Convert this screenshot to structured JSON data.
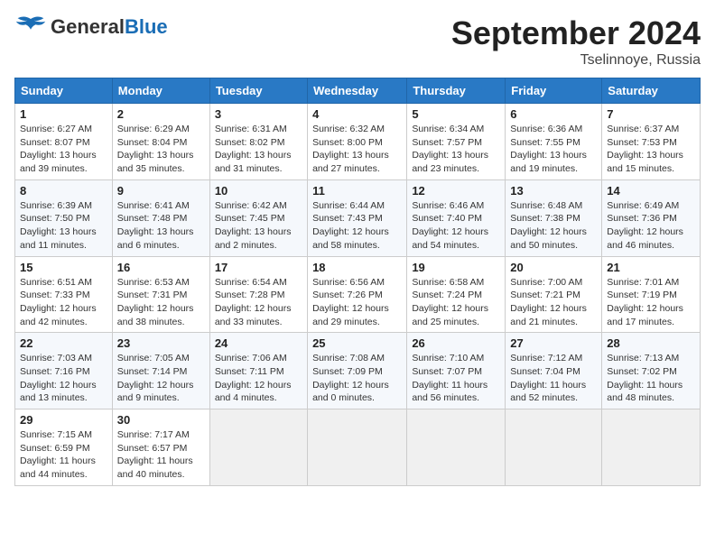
{
  "header": {
    "logo_general": "General",
    "logo_blue": "Blue",
    "month": "September 2024",
    "location": "Tselinnoye, Russia"
  },
  "columns": [
    "Sunday",
    "Monday",
    "Tuesday",
    "Wednesday",
    "Thursday",
    "Friday",
    "Saturday"
  ],
  "weeks": [
    [
      {
        "day": "1",
        "sunrise": "Sunrise: 6:27 AM",
        "sunset": "Sunset: 8:07 PM",
        "daylight": "Daylight: 13 hours and 39 minutes."
      },
      {
        "day": "2",
        "sunrise": "Sunrise: 6:29 AM",
        "sunset": "Sunset: 8:04 PM",
        "daylight": "Daylight: 13 hours and 35 minutes."
      },
      {
        "day": "3",
        "sunrise": "Sunrise: 6:31 AM",
        "sunset": "Sunset: 8:02 PM",
        "daylight": "Daylight: 13 hours and 31 minutes."
      },
      {
        "day": "4",
        "sunrise": "Sunrise: 6:32 AM",
        "sunset": "Sunset: 8:00 PM",
        "daylight": "Daylight: 13 hours and 27 minutes."
      },
      {
        "day": "5",
        "sunrise": "Sunrise: 6:34 AM",
        "sunset": "Sunset: 7:57 PM",
        "daylight": "Daylight: 13 hours and 23 minutes."
      },
      {
        "day": "6",
        "sunrise": "Sunrise: 6:36 AM",
        "sunset": "Sunset: 7:55 PM",
        "daylight": "Daylight: 13 hours and 19 minutes."
      },
      {
        "day": "7",
        "sunrise": "Sunrise: 6:37 AM",
        "sunset": "Sunset: 7:53 PM",
        "daylight": "Daylight: 13 hours and 15 minutes."
      }
    ],
    [
      {
        "day": "8",
        "sunrise": "Sunrise: 6:39 AM",
        "sunset": "Sunset: 7:50 PM",
        "daylight": "Daylight: 13 hours and 11 minutes."
      },
      {
        "day": "9",
        "sunrise": "Sunrise: 6:41 AM",
        "sunset": "Sunset: 7:48 PM",
        "daylight": "Daylight: 13 hours and 6 minutes."
      },
      {
        "day": "10",
        "sunrise": "Sunrise: 6:42 AM",
        "sunset": "Sunset: 7:45 PM",
        "daylight": "Daylight: 13 hours and 2 minutes."
      },
      {
        "day": "11",
        "sunrise": "Sunrise: 6:44 AM",
        "sunset": "Sunset: 7:43 PM",
        "daylight": "Daylight: 12 hours and 58 minutes."
      },
      {
        "day": "12",
        "sunrise": "Sunrise: 6:46 AM",
        "sunset": "Sunset: 7:40 PM",
        "daylight": "Daylight: 12 hours and 54 minutes."
      },
      {
        "day": "13",
        "sunrise": "Sunrise: 6:48 AM",
        "sunset": "Sunset: 7:38 PM",
        "daylight": "Daylight: 12 hours and 50 minutes."
      },
      {
        "day": "14",
        "sunrise": "Sunrise: 6:49 AM",
        "sunset": "Sunset: 7:36 PM",
        "daylight": "Daylight: 12 hours and 46 minutes."
      }
    ],
    [
      {
        "day": "15",
        "sunrise": "Sunrise: 6:51 AM",
        "sunset": "Sunset: 7:33 PM",
        "daylight": "Daylight: 12 hours and 42 minutes."
      },
      {
        "day": "16",
        "sunrise": "Sunrise: 6:53 AM",
        "sunset": "Sunset: 7:31 PM",
        "daylight": "Daylight: 12 hours and 38 minutes."
      },
      {
        "day": "17",
        "sunrise": "Sunrise: 6:54 AM",
        "sunset": "Sunset: 7:28 PM",
        "daylight": "Daylight: 12 hours and 33 minutes."
      },
      {
        "day": "18",
        "sunrise": "Sunrise: 6:56 AM",
        "sunset": "Sunset: 7:26 PM",
        "daylight": "Daylight: 12 hours and 29 minutes."
      },
      {
        "day": "19",
        "sunrise": "Sunrise: 6:58 AM",
        "sunset": "Sunset: 7:24 PM",
        "daylight": "Daylight: 12 hours and 25 minutes."
      },
      {
        "day": "20",
        "sunrise": "Sunrise: 7:00 AM",
        "sunset": "Sunset: 7:21 PM",
        "daylight": "Daylight: 12 hours and 21 minutes."
      },
      {
        "day": "21",
        "sunrise": "Sunrise: 7:01 AM",
        "sunset": "Sunset: 7:19 PM",
        "daylight": "Daylight: 12 hours and 17 minutes."
      }
    ],
    [
      {
        "day": "22",
        "sunrise": "Sunrise: 7:03 AM",
        "sunset": "Sunset: 7:16 PM",
        "daylight": "Daylight: 12 hours and 13 minutes."
      },
      {
        "day": "23",
        "sunrise": "Sunrise: 7:05 AM",
        "sunset": "Sunset: 7:14 PM",
        "daylight": "Daylight: 12 hours and 9 minutes."
      },
      {
        "day": "24",
        "sunrise": "Sunrise: 7:06 AM",
        "sunset": "Sunset: 7:11 PM",
        "daylight": "Daylight: 12 hours and 4 minutes."
      },
      {
        "day": "25",
        "sunrise": "Sunrise: 7:08 AM",
        "sunset": "Sunset: 7:09 PM",
        "daylight": "Daylight: 12 hours and 0 minutes."
      },
      {
        "day": "26",
        "sunrise": "Sunrise: 7:10 AM",
        "sunset": "Sunset: 7:07 PM",
        "daylight": "Daylight: 11 hours and 56 minutes."
      },
      {
        "day": "27",
        "sunrise": "Sunrise: 7:12 AM",
        "sunset": "Sunset: 7:04 PM",
        "daylight": "Daylight: 11 hours and 52 minutes."
      },
      {
        "day": "28",
        "sunrise": "Sunrise: 7:13 AM",
        "sunset": "Sunset: 7:02 PM",
        "daylight": "Daylight: 11 hours and 48 minutes."
      }
    ],
    [
      {
        "day": "29",
        "sunrise": "Sunrise: 7:15 AM",
        "sunset": "Sunset: 6:59 PM",
        "daylight": "Daylight: 11 hours and 44 minutes."
      },
      {
        "day": "30",
        "sunrise": "Sunrise: 7:17 AM",
        "sunset": "Sunset: 6:57 PM",
        "daylight": "Daylight: 11 hours and 40 minutes."
      },
      null,
      null,
      null,
      null,
      null
    ]
  ]
}
